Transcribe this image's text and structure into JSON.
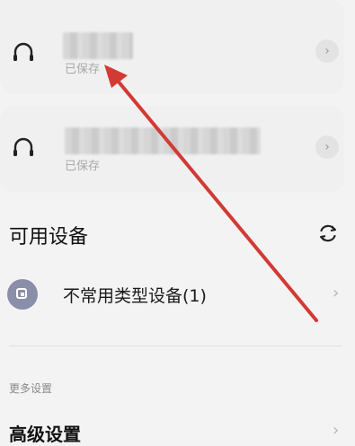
{
  "saved_devices": [
    {
      "status": "已保存",
      "icon": "headphone-icon",
      "chevron": "›"
    },
    {
      "status": "已保存",
      "icon": "headphone-icon",
      "chevron": "›"
    }
  ],
  "available": {
    "title": "可用设备",
    "refresh_icon": "refresh-icon",
    "items": [
      {
        "label": "不常用类型设备(1)",
        "icon": "device-icon",
        "chevron": "›"
      }
    ]
  },
  "more_settings": {
    "label": "更多设置",
    "items": [
      {
        "label": "高级设置",
        "chevron": "›"
      }
    ]
  },
  "colors": {
    "background": "#f3f3f3",
    "card": "#f0f0f0",
    "annotation_arrow": "#d23a34",
    "device_icon": "#8a8ea8"
  }
}
